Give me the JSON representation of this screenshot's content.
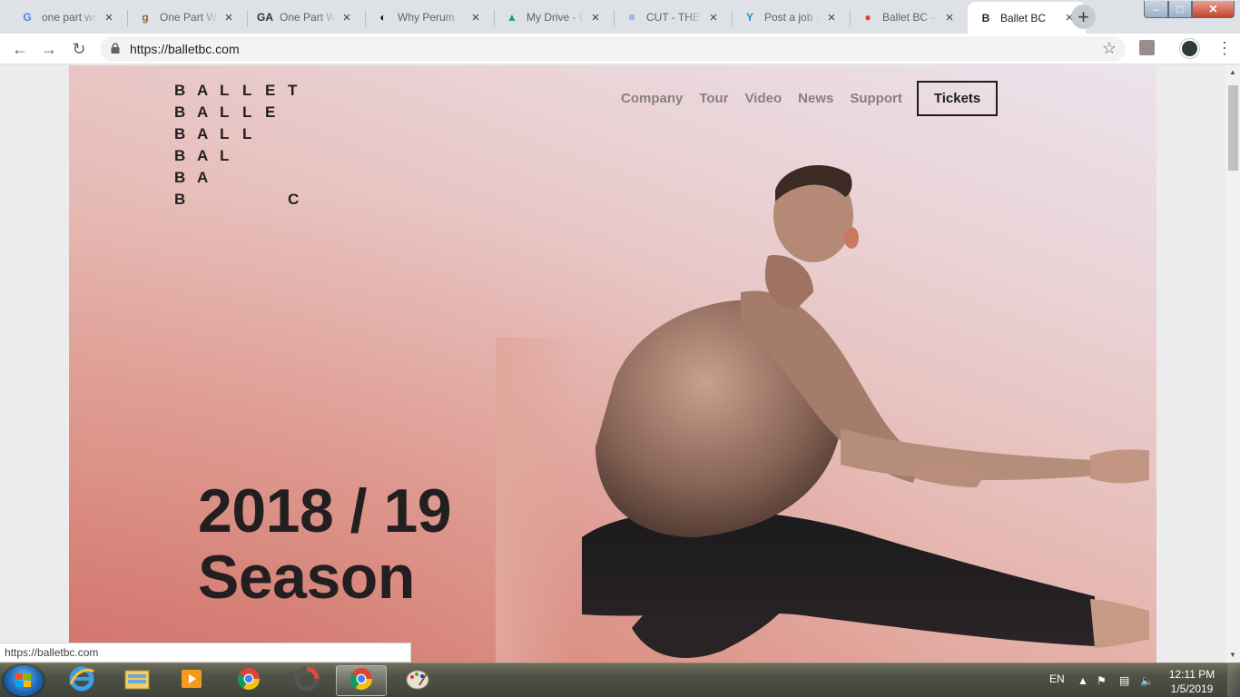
{
  "browser": {
    "tabs": [
      {
        "title": "one part wo",
        "icon": "google-icon",
        "fav": "G",
        "fav_color": "#4285f4"
      },
      {
        "title": "One Part W",
        "icon": "goodreads-icon",
        "fav": "g",
        "fav_color": "#8b6b3d"
      },
      {
        "title": "One Part Wo",
        "icon": "ga-icon",
        "fav": "GA",
        "fav_color": "#333333"
      },
      {
        "title": "Why Perum",
        "icon": "medium-icon",
        "fav": "◐",
        "fav_color": "#111111"
      },
      {
        "title": "My Drive - G",
        "icon": "drive-icon",
        "fav": "▲",
        "fav_color": "#1fa463"
      },
      {
        "title": "CUT - THE P",
        "icon": "docs-icon",
        "fav": "≡",
        "fav_color": "#4285f4"
      },
      {
        "title": "Post a job -",
        "icon": "yuppi-icon",
        "fav": "Y",
        "fav_color": "#1a8fd6"
      },
      {
        "title": "Ballet BC —",
        "icon": "red-dot-icon",
        "fav": "●",
        "fav_color": "#e53935"
      },
      {
        "title": "Ballet BC",
        "icon": "ballet-bc-icon",
        "fav": "B",
        "fav_color": "#202124"
      }
    ],
    "new_tab_label": "+",
    "url": "https://balletbc.com",
    "status_url": "https://balletbc.com"
  },
  "site": {
    "logo_rows": [
      [
        "B",
        "A",
        "L",
        "L",
        "E",
        "T"
      ],
      [
        "B",
        "A",
        "L",
        "L",
        "E",
        ""
      ],
      [
        "B",
        "A",
        "L",
        "L",
        "",
        ""
      ],
      [
        "B",
        "A",
        "L",
        "",
        "",
        ""
      ],
      [
        "B",
        "A",
        "",
        "",
        "",
        ""
      ],
      [
        "B",
        "",
        "",
        "",
        "",
        "C"
      ]
    ],
    "nav": [
      "Company",
      "Tour",
      "Video",
      "News",
      "Support"
    ],
    "tickets_label": "Tickets",
    "season_line1": "2018 / 19",
    "season_line2": "Season",
    "colors": {
      "text_dark": "#231f20",
      "nav_gray": "#8a7f7f",
      "hero_top": "#ece3ec",
      "hero_bottom": "#d37870"
    }
  },
  "taskbar": {
    "items": [
      {
        "name": "ie-icon"
      },
      {
        "name": "explorer-icon"
      },
      {
        "name": "media-player-icon"
      },
      {
        "name": "chrome-icon"
      },
      {
        "name": "app-icon"
      },
      {
        "name": "chrome-icon",
        "active": true
      },
      {
        "name": "paint-icon"
      }
    ],
    "language": "EN",
    "time": "12:11 PM",
    "date": "1/5/2019"
  }
}
